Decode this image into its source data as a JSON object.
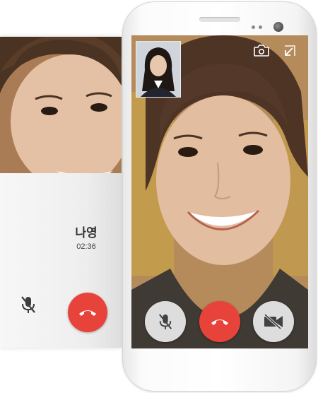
{
  "call": {
    "caller_name": "나영",
    "duration": "02:36"
  },
  "icons": {
    "mute": "mic-off-icon",
    "video": "videocam-icon",
    "video_off": "videocam-off-icon",
    "end_call": "call-end-icon",
    "switch_camera": "switch-camera-icon",
    "minimize": "minimize-arrow-icon"
  },
  "colors": {
    "end_call": "#e8433a",
    "control_light": "#f0f0f0",
    "icon_dark": "#424242"
  }
}
